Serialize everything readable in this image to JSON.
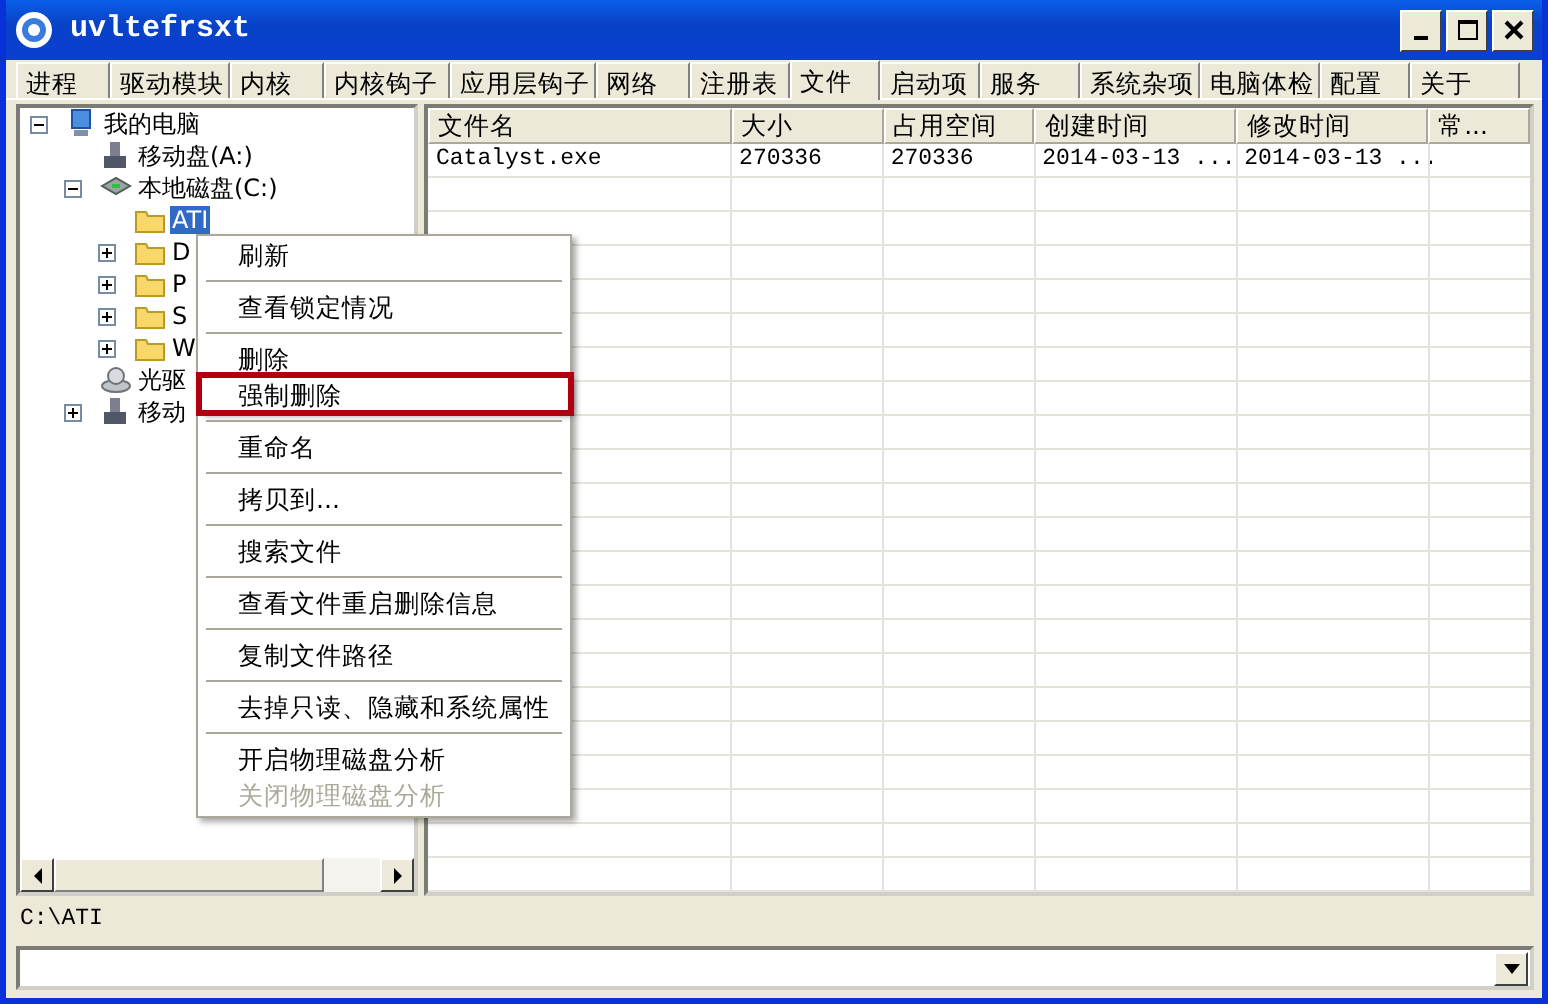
{
  "window": {
    "title": "uvltefrsxt"
  },
  "tabs": [
    {
      "label": "进程",
      "selected": false
    },
    {
      "label": "驱动模块",
      "selected": false
    },
    {
      "label": "内核",
      "selected": false
    },
    {
      "label": "内核钩子",
      "selected": false
    },
    {
      "label": "应用层钩子",
      "selected": false
    },
    {
      "label": "网络",
      "selected": false
    },
    {
      "label": "注册表",
      "selected": false
    },
    {
      "label": "文件",
      "selected": true
    },
    {
      "label": "启动项",
      "selected": false
    },
    {
      "label": "服务",
      "selected": false
    },
    {
      "label": "系统杂项",
      "selected": false
    },
    {
      "label": "电脑体检",
      "selected": false
    },
    {
      "label": "配置",
      "selected": false
    },
    {
      "label": "关于",
      "selected": false
    }
  ],
  "tree": [
    {
      "label": "我的电脑",
      "kind": "computer",
      "expanded": true,
      "selected": false,
      "children": [
        {
          "label": "移动盘(A:)",
          "kind": "removable",
          "selected": false
        },
        {
          "label": "本地磁盘(C:)",
          "kind": "disk",
          "expanded": true,
          "selected": false,
          "children": [
            {
              "label": "ATI",
              "kind": "folder",
              "selected": true
            },
            {
              "label": "D",
              "kind": "folder",
              "expanded": false,
              "selected": false
            },
            {
              "label": "P",
              "kind": "folder",
              "expanded": false,
              "selected": false
            },
            {
              "label": "S",
              "kind": "folder",
              "expanded": false,
              "selected": false
            },
            {
              "label": "W",
              "kind": "folder",
              "expanded": false,
              "selected": false
            }
          ]
        },
        {
          "label": "光驱",
          "kind": "cdrom",
          "selected": false
        },
        {
          "label": "移动",
          "kind": "removable",
          "expanded": false,
          "selected": false
        }
      ]
    }
  ],
  "table": {
    "columns": [
      "文件名",
      "大小",
      "占用空间",
      "创建时间",
      "修改时间",
      "常..."
    ],
    "rows": [
      [
        "Catalyst.exe",
        "270336",
        "270336",
        "2014-03-13 ...",
        "2014-03-13 ...",
        ""
      ]
    ]
  },
  "context_menu": [
    {
      "kind": "item",
      "label": "刷新"
    },
    {
      "kind": "separator"
    },
    {
      "kind": "item",
      "label": "查看锁定情况"
    },
    {
      "kind": "separator"
    },
    {
      "kind": "item",
      "label": "删除"
    },
    {
      "kind": "item",
      "label": "强制删除",
      "highlighted": true
    },
    {
      "kind": "separator"
    },
    {
      "kind": "item",
      "label": "重命名"
    },
    {
      "kind": "separator"
    },
    {
      "kind": "item",
      "label": "拷贝到..."
    },
    {
      "kind": "separator"
    },
    {
      "kind": "item",
      "label": "搜索文件"
    },
    {
      "kind": "separator"
    },
    {
      "kind": "item",
      "label": "查看文件重启删除信息"
    },
    {
      "kind": "separator"
    },
    {
      "kind": "item",
      "label": "复制文件路径"
    },
    {
      "kind": "separator"
    },
    {
      "kind": "item",
      "label": "去掉只读、隐藏和系统属性"
    },
    {
      "kind": "separator"
    },
    {
      "kind": "item",
      "label": "开启物理磁盘分析"
    },
    {
      "kind": "item",
      "label": "关闭物理磁盘分析",
      "disabled": true
    }
  ],
  "status_bar": "C:\\ATI"
}
